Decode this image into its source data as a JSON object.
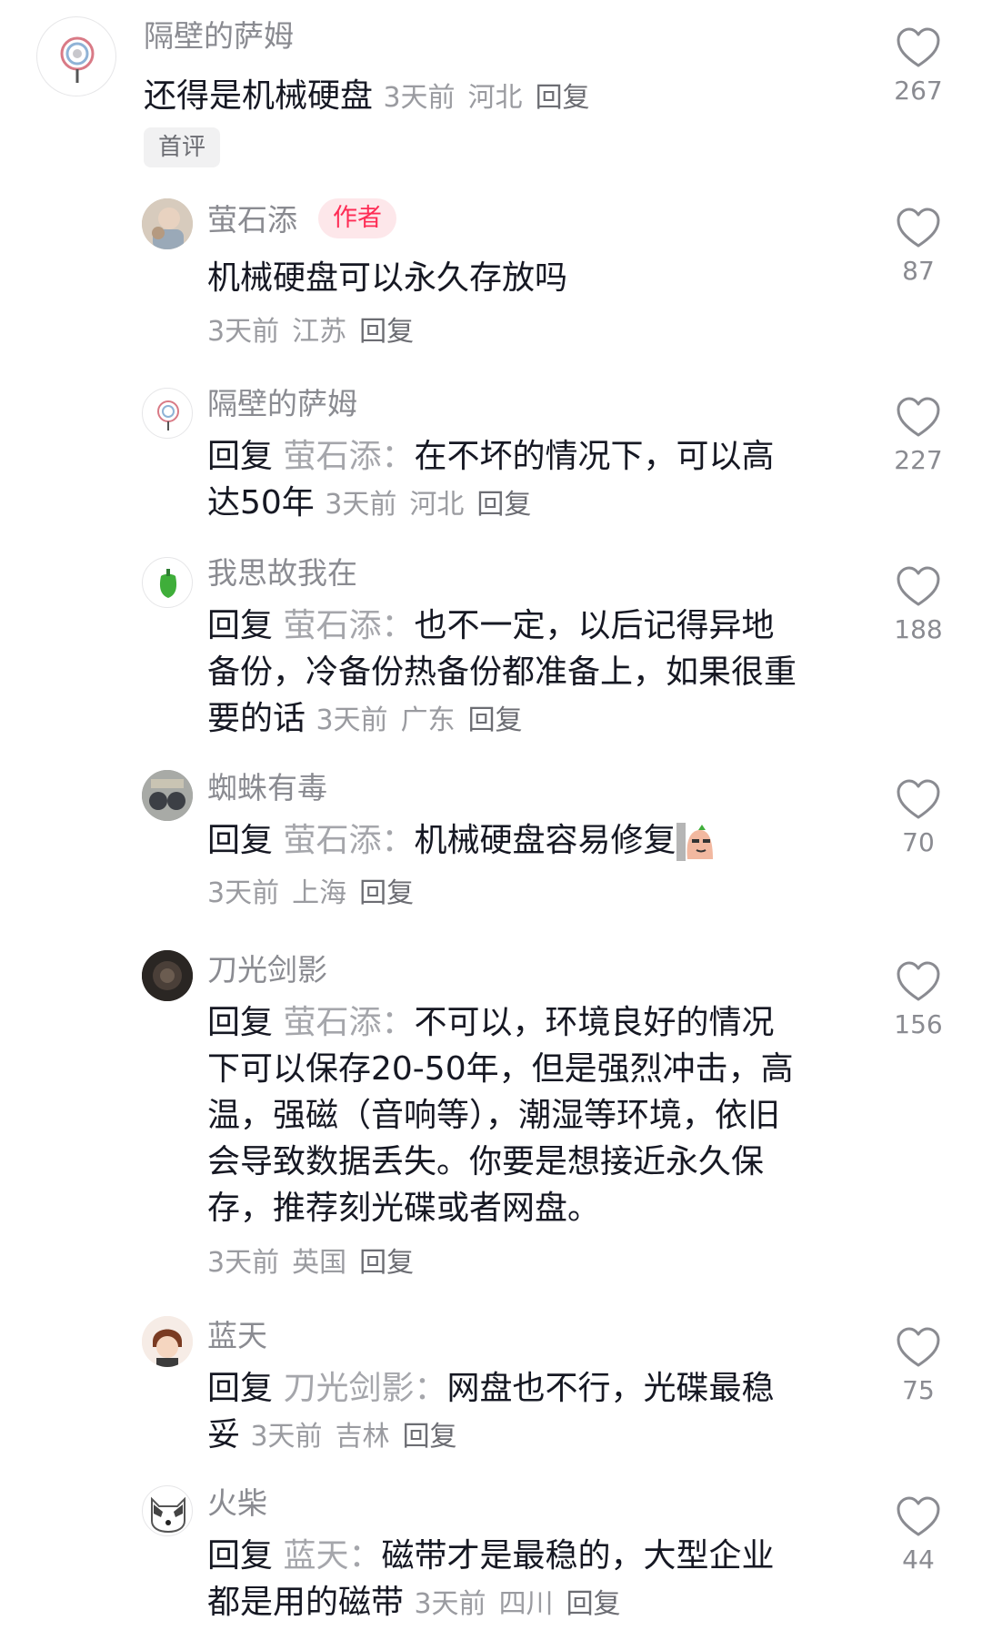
{
  "comments": [
    {
      "username": "隔壁的萨姆",
      "text": "还得是机械硬盘",
      "badge": "首评",
      "time": "3天前",
      "location": "河北",
      "reply": "回复",
      "likes": "267"
    },
    {
      "username": "萤石添",
      "badge": "作者",
      "text": "机械硬盘可以永久存放吗",
      "time": "3天前",
      "location": "江苏",
      "reply": "回复",
      "likes": "87"
    },
    {
      "username": "隔壁的萨姆",
      "prefix": "回复",
      "target": "萤石添：",
      "line1": "在不坏的情况下，可以高",
      "line2": "达50年",
      "time": "3天前",
      "location": "河北",
      "reply": "回复",
      "likes": "227"
    },
    {
      "username": "我思故我在",
      "prefix": "回复",
      "target": "萤石添：",
      "line1": "也不一定，以后记得异地",
      "line2": "备份，冷备份热备份都准备上，如果很重",
      "line3": "要的话",
      "time": "3天前",
      "location": "广东",
      "reply": "回复",
      "likes": "188"
    },
    {
      "username": "蜘蛛有毒",
      "prefix": "回复",
      "target": "萤石添：",
      "line1": "机械硬盘容易修复",
      "emoji": "sticker-emoji",
      "time": "3天前",
      "location": "上海",
      "reply": "回复",
      "likes": "70"
    },
    {
      "username": "刀光剑影",
      "prefix": "回复",
      "target": "萤石添：",
      "line1": "不可以，环境良好的情况",
      "line2": "下可以保存20-50年，但是强烈冲击，高",
      "line3": "温，强磁（音响等），潮湿等环境，依旧",
      "line4": "会导致数据丢失。你要是想接近永久保",
      "line5": "存，推荐刻光碟或者网盘。",
      "time": "3天前",
      "location": "英国",
      "reply": "回复",
      "likes": "156"
    },
    {
      "username": "蓝天",
      "prefix": "回复",
      "target": "刀光剑影：",
      "line1": "网盘也不行，光碟最稳",
      "line2": "妥",
      "time": "3天前",
      "location": "吉林",
      "reply": "回复",
      "likes": "75"
    },
    {
      "username": "火柴",
      "prefix": "回复",
      "target": "蓝天：",
      "line1": "磁带才是最稳的，大型企业",
      "line2": "都是用的磁带",
      "time": "3天前",
      "location": "四川",
      "reply": "回复",
      "likes": "44"
    }
  ],
  "icons": {
    "like": "heart-outline-icon"
  },
  "colors": {
    "author_badge": "#fe2c55",
    "text": "#161823",
    "secondary": "#8a8b91"
  }
}
